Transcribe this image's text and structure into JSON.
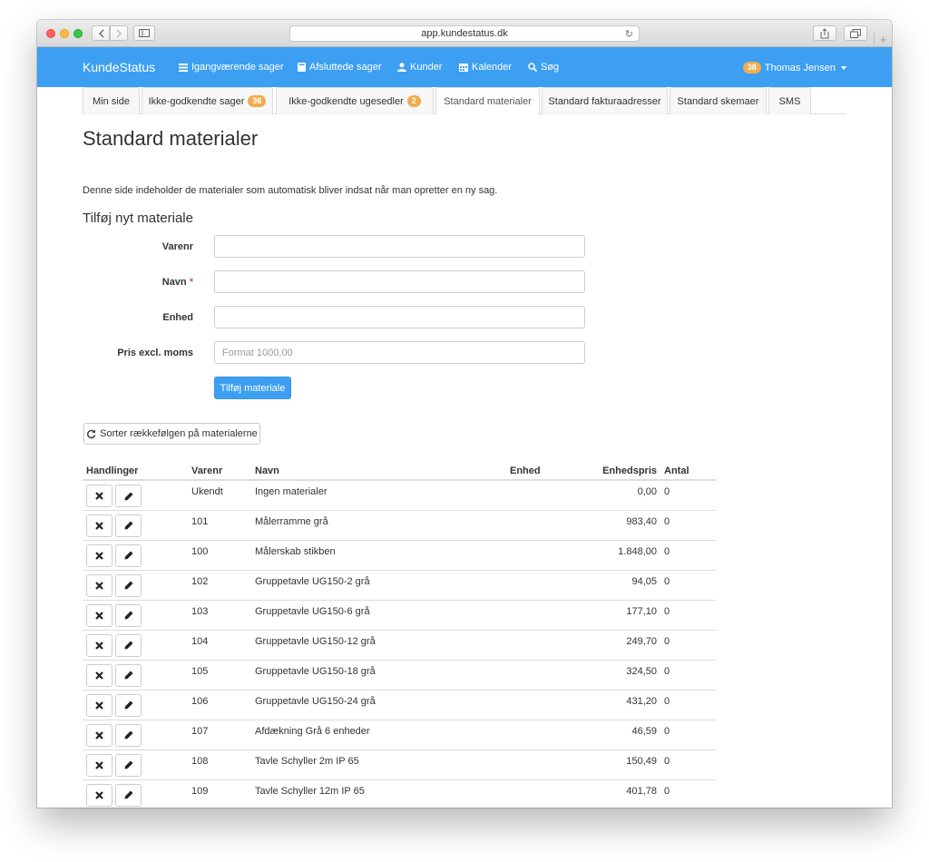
{
  "browser": {
    "url": "app.kundestatus.dk"
  },
  "navbar": {
    "brand": "KundeStatus",
    "items": [
      {
        "label": "Igangværende sager",
        "icon": "list-icon"
      },
      {
        "label": "Afsluttede sager",
        "icon": "book-icon"
      },
      {
        "label": "Kunder",
        "icon": "user-icon"
      },
      {
        "label": "Kalender",
        "icon": "calendar-icon"
      },
      {
        "label": "Søg",
        "icon": "search-icon"
      }
    ],
    "user": {
      "name": "Thomas Jensen",
      "badge": "38"
    }
  },
  "tabs": [
    {
      "label": "Min side",
      "badge": ""
    },
    {
      "label": "Ikke-godkendte sager",
      "badge": "36"
    },
    {
      "label": "Ikke-godkendte ugesedler",
      "badge": "2"
    },
    {
      "label": "Standard materialer",
      "badge": ""
    },
    {
      "label": "Standard fakturaadresser",
      "badge": ""
    },
    {
      "label": "Standard skemaer",
      "badge": ""
    },
    {
      "label": "SMS",
      "badge": ""
    }
  ],
  "active_tab": "Standard materialer",
  "page": {
    "title": "Standard materialer",
    "description": "Denne side indeholder de materialer som automatisk bliver indsat når man opretter en ny sag.",
    "form_title": "Tilføj nyt materiale"
  },
  "form": {
    "varenr_label": "Varenr",
    "navn_label": "Navn",
    "required_mark": "*",
    "enhed_label": "Enhed",
    "pris_label": "Pris excl. moms",
    "pris_placeholder": "Format 1000,00",
    "submit_label": "Tilføj materiale"
  },
  "sort_button": "Sorter rækkefølgen på materialerne",
  "table": {
    "headers": [
      "Handlinger",
      "Varenr",
      "Navn",
      "Enhed",
      "Enhedspris",
      "Antal"
    ],
    "rows": [
      {
        "varenr": "Ukendt",
        "navn": "Ingen materialer",
        "enhed": "",
        "pris": "0,00",
        "antal": "0"
      },
      {
        "varenr": "101",
        "navn": "Målerramme grå",
        "enhed": "",
        "pris": "983,40",
        "antal": "0"
      },
      {
        "varenr": "100",
        "navn": "Målerskab stikben",
        "enhed": "",
        "pris": "1.848,00",
        "antal": "0"
      },
      {
        "varenr": "102",
        "navn": "Gruppetavle UG150-2 grå",
        "enhed": "",
        "pris": "94,05",
        "antal": "0"
      },
      {
        "varenr": "103",
        "navn": "Gruppetavle UG150-6 grå",
        "enhed": "",
        "pris": "177,10",
        "antal": "0"
      },
      {
        "varenr": "104",
        "navn": "Gruppetavle UG150-12 grå",
        "enhed": "",
        "pris": "249,70",
        "antal": "0"
      },
      {
        "varenr": "105",
        "navn": "Gruppetavle UG150-18 grå",
        "enhed": "",
        "pris": "324,50",
        "antal": "0"
      },
      {
        "varenr": "106",
        "navn": "Gruppetavle UG150-24 grå",
        "enhed": "",
        "pris": "431,20",
        "antal": "0"
      },
      {
        "varenr": "107",
        "navn": "Afdækning Grå 6 enheder",
        "enhed": "",
        "pris": "46,59",
        "antal": "0"
      },
      {
        "varenr": "108",
        "navn": "Tavle Schyller 2m IP 65",
        "enhed": "",
        "pris": "150,49",
        "antal": "0"
      },
      {
        "varenr": "109",
        "navn": "Tavle Schyller 12m IP 65",
        "enhed": "",
        "pris": "401,78",
        "antal": "0"
      }
    ]
  },
  "colors": {
    "navbar": "#3d9ff2",
    "badge": "#f0ad4e",
    "required": "#d9534f"
  }
}
